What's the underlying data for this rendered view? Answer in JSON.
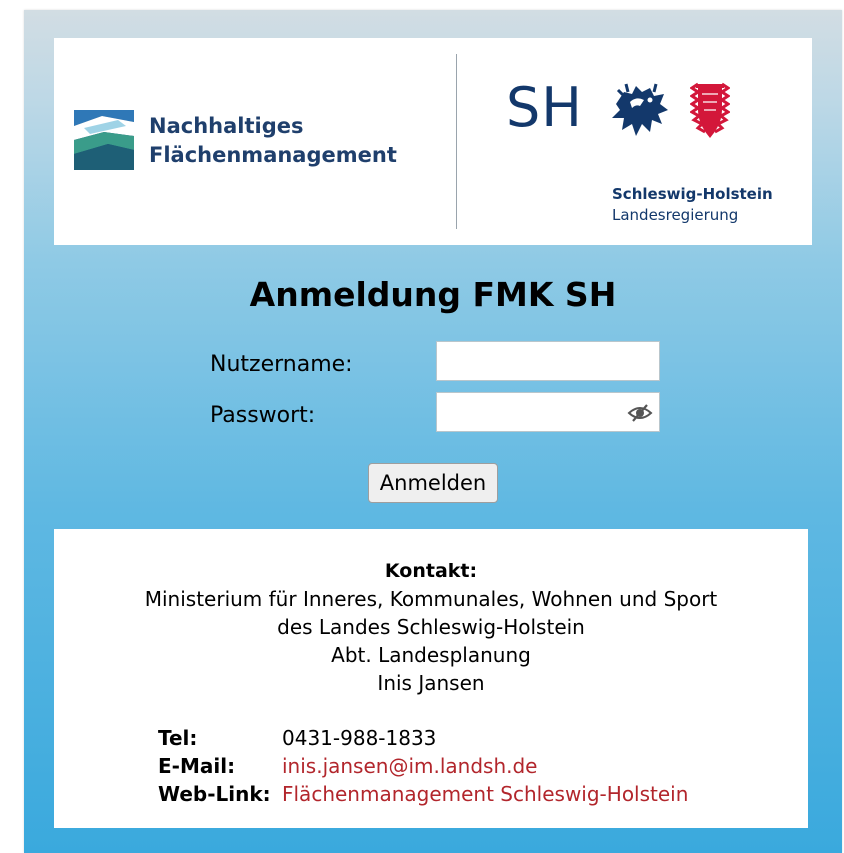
{
  "header": {
    "left_logo_line1": "Nachhaltiges",
    "left_logo_line2": "Flächenmanagement",
    "sh_letters": "SH",
    "sh_name": "Schleswig-Holstein",
    "sh_sub": "Landesregierung",
    "left_logo_icon": "nachhaltiges-flaechenmanagement-logo-icon",
    "lion_icon": "lion-coat-of-arms-icon",
    "nettle_icon": "nettle-leaf-coat-of-arms-icon"
  },
  "login": {
    "title": "Anmeldung FMK SH",
    "username_label": "Nutzername:",
    "username_value": "",
    "password_label": "Passwort:",
    "password_value": "",
    "toggle_icon": "eye-slash-icon",
    "submit_label": "Anmelden"
  },
  "contact": {
    "heading": "Kontakt:",
    "line1": "Ministerium für Inneres, Kommunales, Wohnen und Sport",
    "line2": "des Landes Schleswig-Holstein",
    "line3": "Abt. Landesplanung",
    "line4": "Inis Jansen",
    "tel_label": "Tel:",
    "tel_value": "0431-988-1833",
    "email_label": "E-Mail:",
    "email_value": "inis.jansen@im.landsh.de",
    "web_label": "Web-Link:",
    "web_value": "Flächenmanagement Schleswig-Holstein"
  },
  "colors": {
    "brand_navy": "#13386b",
    "link_red": "#b2262c",
    "gradient_top": "#d2dde3",
    "gradient_bottom": "#3aa9dd"
  }
}
